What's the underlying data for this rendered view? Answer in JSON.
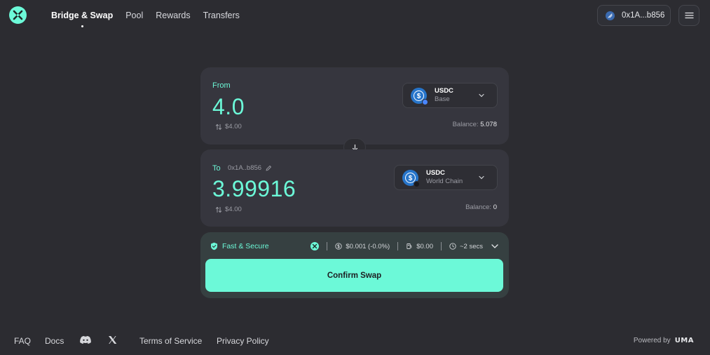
{
  "header": {
    "nav": [
      {
        "label": "Bridge & Swap",
        "active": true
      },
      {
        "label": "Pool",
        "active": false
      },
      {
        "label": "Rewards",
        "active": false
      },
      {
        "label": "Transfers",
        "active": false
      }
    ],
    "wallet_label": "0x1A...b856",
    "logo_icon": "x-logo-icon",
    "menu_icon": "hamburger-menu-icon"
  },
  "from": {
    "label": "From",
    "amount": "4.0",
    "usd": "$4.00",
    "token_symbol": "USDC",
    "token_chain": "Base",
    "balance_label": "Balance:",
    "balance_value": "5.078"
  },
  "to": {
    "label": "To",
    "address": "0x1A..b856",
    "amount": "3.99916",
    "usd": "$4.00",
    "token_symbol": "USDC",
    "token_chain": "World Chain",
    "balance_label": "Balance:",
    "balance_value": "0"
  },
  "summary": {
    "secure_label": "Fast & Secure",
    "fee": "$0.001 (-0.0%)",
    "gas": "$0.00",
    "time": "~2 secs",
    "confirm_label": "Confirm Swap"
  },
  "footer": {
    "faq": "FAQ",
    "docs": "Docs",
    "terms": "Terms of Service",
    "privacy": "Privacy Policy",
    "powered_by": "Powered by",
    "powered_brand": "UMA"
  },
  "colors": {
    "background": "#2c2c31",
    "card": "#36363e",
    "accent": "#6cf9d8",
    "usdc_blue": "#2775ca"
  }
}
